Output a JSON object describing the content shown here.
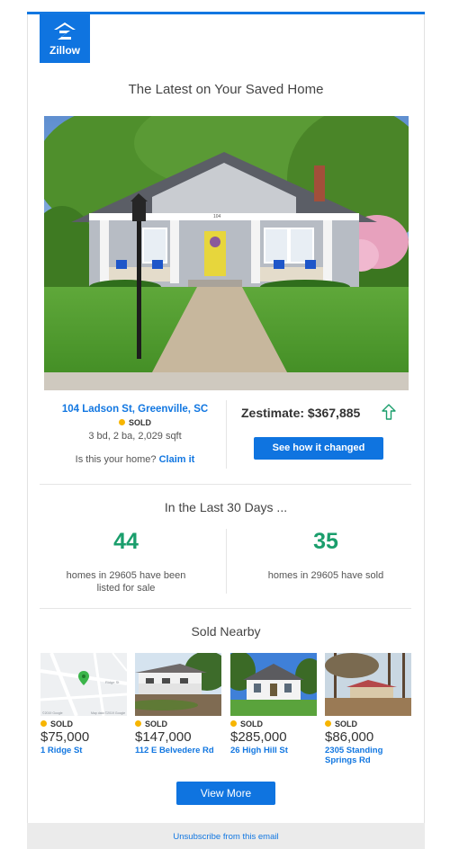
{
  "brand": {
    "name": "Zillow",
    "accent_color": "#0f74e0",
    "stat_color": "#1a9e6c",
    "sold_dot_color": "#f7b500"
  },
  "header": {
    "headline": "The Latest on Your Saved Home"
  },
  "saved_home": {
    "address": "104 Ladson St, Greenville, SC",
    "status": "SOLD",
    "facts": "3 bd, 2 ba, 2,029 sqft",
    "claim_prompt": "Is this your home?",
    "claim_link": "Claim it",
    "house_number_plate": "104"
  },
  "zestimate": {
    "label": "Zestimate: $367,885",
    "trend_icon": "arrow-up-icon",
    "button_label": "See how it changed"
  },
  "last30": {
    "title": "In the Last 30 Days ...",
    "stats": [
      {
        "value": "44",
        "label_line1": "homes in 29605 have been",
        "label_line2": "listed for sale"
      },
      {
        "value": "35",
        "label_line1": "homes in 29605 have sold",
        "label_line2": ""
      }
    ]
  },
  "sold_nearby": {
    "title": "Sold Nearby",
    "map_streets": {
      "road": "Ridge St",
      "credit_left": "©2019 Google",
      "credit_right": "Map data ©2019 Google"
    },
    "cards": [
      {
        "status": "SOLD",
        "price": "$75,000",
        "address_line1": "1 Ridge St",
        "address_line2": ""
      },
      {
        "status": "SOLD",
        "price": "$147,000",
        "address_line1": "112 E Belvedere Rd",
        "address_line2": ""
      },
      {
        "status": "SOLD",
        "price": "$285,000",
        "address_line1": "26 High Hill St",
        "address_line2": ""
      },
      {
        "status": "SOLD",
        "price": "$86,000",
        "address_line1": "2305 Standing",
        "address_line2": "Springs Rd"
      }
    ],
    "view_more_label": "View More"
  },
  "footer": {
    "unsubscribe_label": "Unsubscribe from this email"
  }
}
